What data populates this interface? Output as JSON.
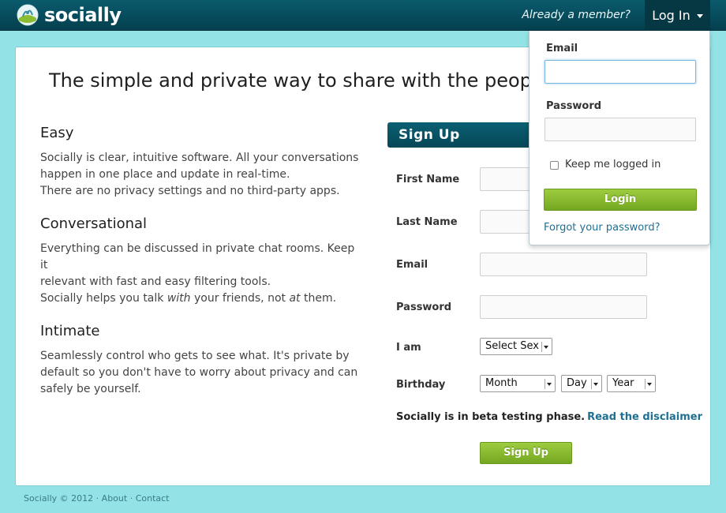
{
  "header": {
    "logo_text": "socially",
    "member_text": "Already a member?",
    "login_label": "Log In"
  },
  "main": {
    "headline": "The simple and private way to share with the people",
    "features": [
      {
        "title": "Easy",
        "lines": [
          "Socially is clear, intuitive software. All your conversations",
          "happen in one place and update in real-time.",
          "There are no privacy settings and no third-party apps."
        ]
      },
      {
        "title": "Conversational",
        "lines": [
          "Everything can be discussed in private chat rooms. Keep it",
          "relevant with fast and easy filtering tools."
        ],
        "last_line": {
          "a": "Socially helps you talk ",
          "em1": "with",
          "b": " your friends, not ",
          "em2": "at",
          "c": " them."
        }
      },
      {
        "title": "Intimate",
        "lines": [
          "Seamlessly control who gets to see what. It's private by",
          "default so you don't have to worry about privacy and can",
          "safely be yourself."
        ]
      }
    ]
  },
  "signup": {
    "title": "Sign Up",
    "first_name_label": "First Name",
    "last_name_label": "Last Name",
    "email_label": "Email",
    "password_label": "Password",
    "sex_label": "I am",
    "sex_value": "Select Sex",
    "birthday_label": "Birthday",
    "month_value": "Month",
    "day_value": "Day",
    "year_value": "Year",
    "beta_text": "Socially is in beta testing phase.",
    "disclaimer_link": "Read the disclaimer",
    "button_label": "Sign Up"
  },
  "login_panel": {
    "email_label": "Email",
    "password_label": "Password",
    "keep_label": "Keep me logged in",
    "button_label": "Login",
    "forgot_link": "Forgot your password?"
  },
  "footer": {
    "copyright": "Socially © 2012",
    "sep": "·",
    "about": "About",
    "contact": "Contact"
  },
  "colors": {
    "background": "#93e3e6",
    "header": "#064758",
    "accent_green": "#8bbd33",
    "link": "#1f6f92"
  }
}
